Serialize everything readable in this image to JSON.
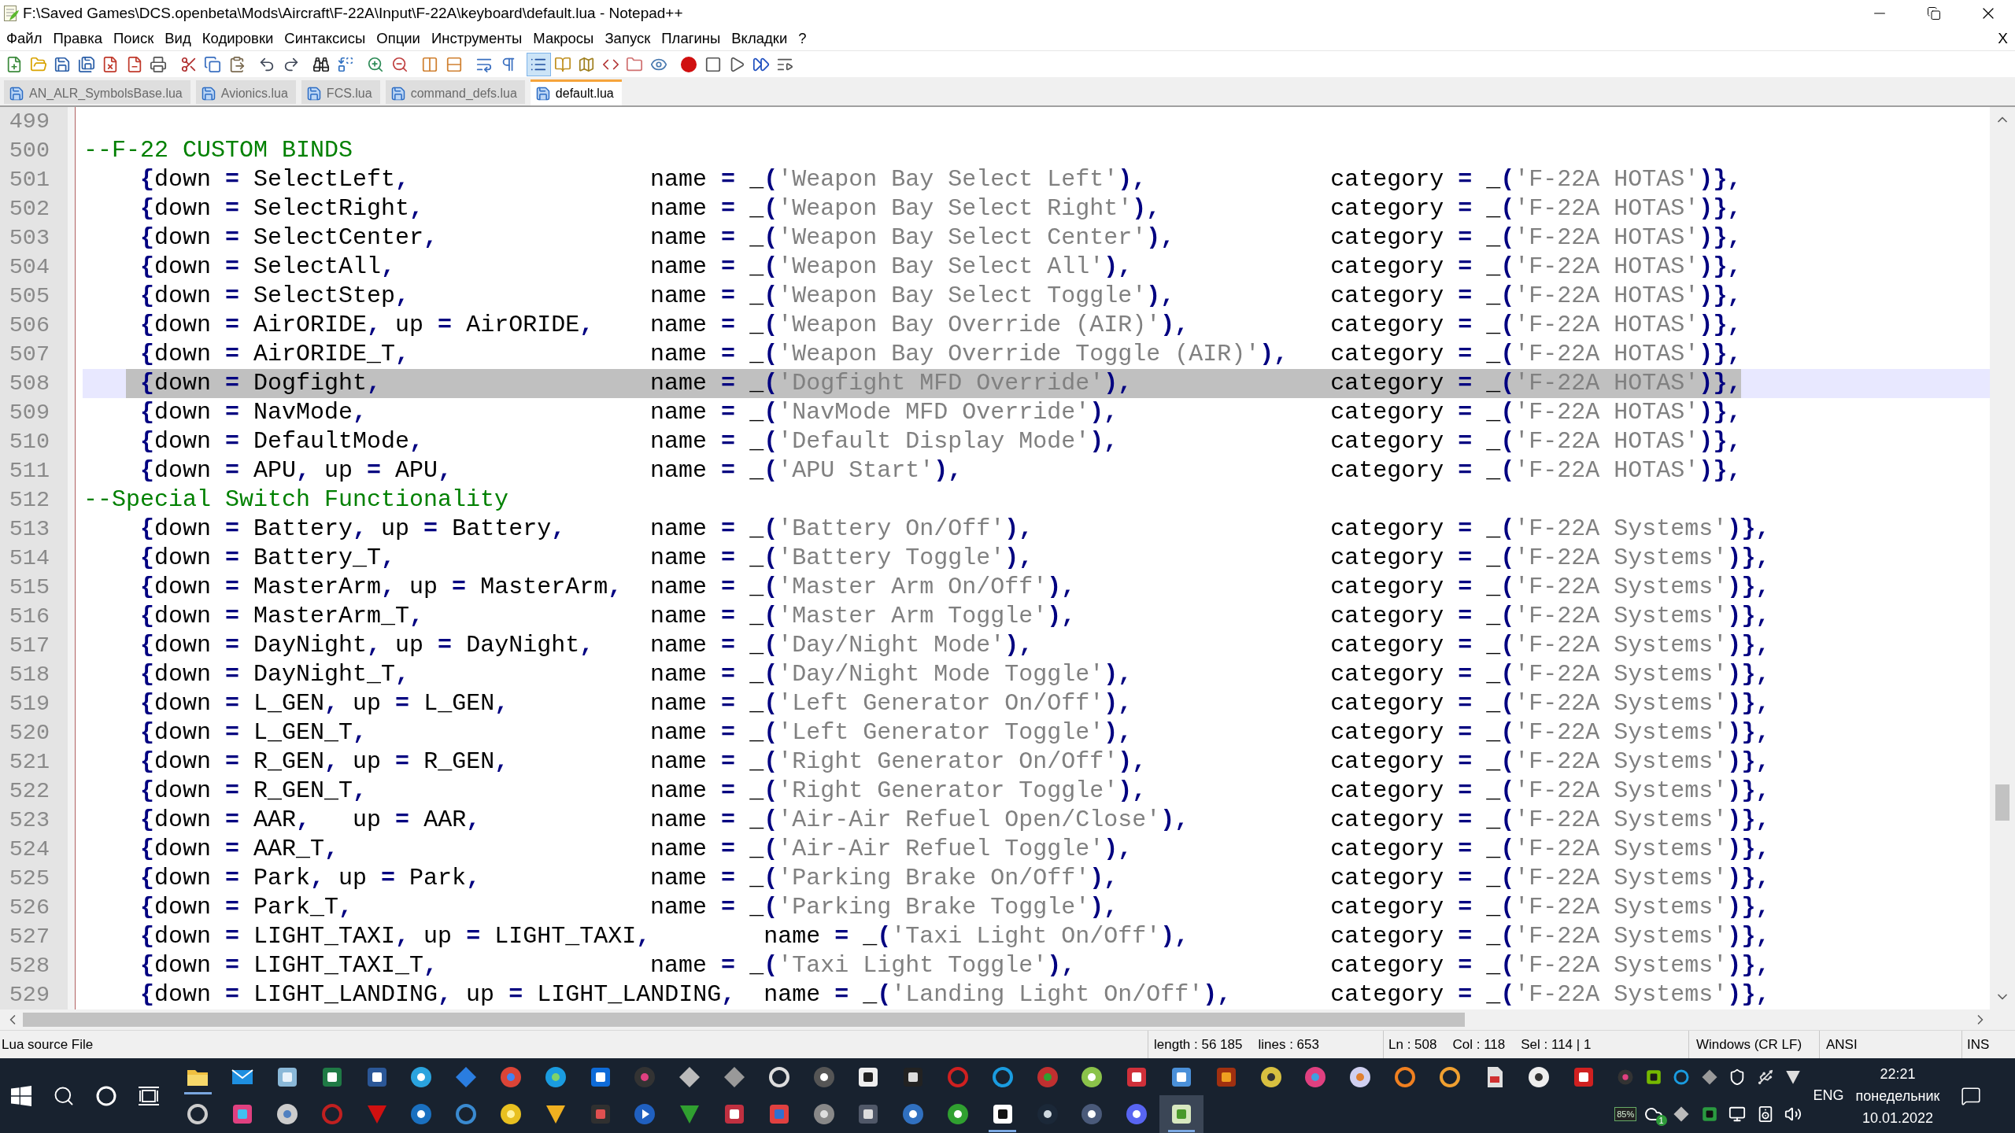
{
  "window": {
    "title": "F:\\Saved Games\\DCS.openbeta\\Mods\\Aircraft\\F-22A\\Input\\F-22A\\keyboard\\default.lua - Notepad++"
  },
  "menu": {
    "items": [
      "Файл",
      "Правка",
      "Поиск",
      "Вид",
      "Кодировки",
      "Синтаксисы",
      "Опции",
      "Инструменты",
      "Макросы",
      "Запуск",
      "Плагины",
      "Вкладки",
      "?"
    ],
    "close": "X"
  },
  "toolbar": {
    "buttons": [
      {
        "pressed": false
      },
      {
        "pressed": false
      },
      {
        "pressed": false
      },
      {
        "pressed": false
      },
      {
        "pressed": false
      },
      {
        "pressed": false
      },
      {
        "pressed": false
      },
      {
        "pressed": false
      },
      {
        "pressed": false
      },
      {
        "pressed": false
      },
      {
        "pressed": false
      },
      {
        "pressed": false
      },
      {
        "pressed": false
      },
      {
        "pressed": false
      },
      {
        "pressed": false
      },
      {
        "pressed": false
      },
      {
        "pressed": false
      },
      {
        "pressed": false
      },
      {
        "pressed": false
      },
      {
        "pressed": false
      },
      {
        "pressed": true
      },
      {
        "pressed": false
      },
      {
        "pressed": false
      },
      {
        "pressed": false
      },
      {
        "pressed": false
      },
      {
        "pressed": false
      },
      {
        "pressed": false
      },
      {
        "pressed": false
      },
      {
        "pressed": false
      },
      {
        "pressed": false
      },
      {
        "pressed": false
      }
    ]
  },
  "tabs": [
    {
      "label": "AN_ALR_SymbolsBase.lua",
      "selected": false
    },
    {
      "label": "Avionics.lua",
      "selected": false
    },
    {
      "label": "FCS.lua",
      "selected": false
    },
    {
      "label": "command_defs.lua",
      "selected": false
    },
    {
      "label": "default.lua",
      "selected": true
    }
  ],
  "editor": {
    "lines": [
      {
        "number": "499",
        "kind": "blank",
        "selected": false
      },
      {
        "number": "500",
        "kind": "comment",
        "text": "--F-22 CUSTOM BINDS",
        "selected": false
      },
      {
        "number": "501",
        "kind": "bind",
        "binding": "{down = SelectLeft,",
        "name": "name = _('Weapon Bay Select Left'),",
        "category": "category = _('F-22A HOTAS')},",
        "selected": false
      },
      {
        "number": "502",
        "kind": "bind",
        "binding": "{down = SelectRight,",
        "name": "name = _('Weapon Bay Select Right'),",
        "category": "category = _('F-22A HOTAS')},",
        "selected": false
      },
      {
        "number": "503",
        "kind": "bind",
        "binding": "{down = SelectCenter,",
        "name": "name = _('Weapon Bay Select Center'),",
        "category": "category = _('F-22A HOTAS')},",
        "selected": false
      },
      {
        "number": "504",
        "kind": "bind",
        "binding": "{down = SelectAll,",
        "name": "name = _('Weapon Bay Select All'),",
        "category": "category = _('F-22A HOTAS')},",
        "selected": false
      },
      {
        "number": "505",
        "kind": "bind",
        "binding": "{down = SelectStep,",
        "name": "name = _('Weapon Bay Select Toggle'),",
        "category": "category = _('F-22A HOTAS')},",
        "selected": false
      },
      {
        "number": "506",
        "kind": "bind",
        "binding": "{down = AirORIDE, up = AirORIDE,",
        "name": "name = _('Weapon Bay Override (AIR)'),",
        "category": "category = _('F-22A HOTAS')},",
        "selected": false
      },
      {
        "number": "507",
        "kind": "bind",
        "binding": "{down = AirORIDE_T,",
        "name": "name = _('Weapon Bay Override Toggle (AIR)'),",
        "category": "category = _('F-22A HOTAS')},",
        "selected": false
      },
      {
        "number": "508",
        "kind": "bind",
        "binding": "{down = Dogfight,",
        "name": "name = _('Dogfight MFD Override'),",
        "category": "category = _('F-22A HOTAS')},",
        "selected": true
      },
      {
        "number": "509",
        "kind": "bind",
        "binding": "{down = NavMode,",
        "name": "name = _('NavMode MFD Override'),",
        "category": "category = _('F-22A HOTAS')},",
        "selected": false
      },
      {
        "number": "510",
        "kind": "bind",
        "binding": "{down = DefaultMode,",
        "name": "name = _('Default Display Mode'),",
        "category": "category = _('F-22A HOTAS')},",
        "selected": false
      },
      {
        "number": "511",
        "kind": "bind",
        "binding": "{down = APU, up = APU,",
        "name": "name = _('APU Start'),",
        "category": "category = _('F-22A HOTAS')},",
        "selected": false
      },
      {
        "number": "512",
        "kind": "comment",
        "text": "--Special Switch Functionality",
        "selected": false
      },
      {
        "number": "513",
        "kind": "bind",
        "binding": "{down = Battery, up = Battery,",
        "name": "name = _('Battery On/Off'),",
        "category": "category = _('F-22A Systems')},",
        "selected": false
      },
      {
        "number": "514",
        "kind": "bind",
        "binding": "{down = Battery_T,",
        "name": "name = _('Battery Toggle'),",
        "category": "category = _('F-22A Systems')},",
        "selected": false
      },
      {
        "number": "515",
        "kind": "bind",
        "binding": "{down = MasterArm, up = MasterArm,",
        "name": "name = _('Master Arm On/Off'),",
        "category": "category = _('F-22A Systems')},",
        "selected": false
      },
      {
        "number": "516",
        "kind": "bind",
        "binding": "{down = MasterArm_T,",
        "name": "name = _('Master Arm Toggle'),",
        "category": "category = _('F-22A Systems')},",
        "selected": false
      },
      {
        "number": "517",
        "kind": "bind",
        "binding": "{down = DayNight, up = DayNight,",
        "name": "name = _('Day/Night Mode'),",
        "category": "category = _('F-22A Systems')},",
        "selected": false
      },
      {
        "number": "518",
        "kind": "bind",
        "binding": "{down = DayNight_T,",
        "name": "name = _('Day/Night Mode Toggle'),",
        "category": "category = _('F-22A Systems')},",
        "selected": false
      },
      {
        "number": "519",
        "kind": "bind",
        "binding": "{down = L_GEN, up = L_GEN,",
        "name": "name = _('Left Generator On/Off'),",
        "category": "category = _('F-22A Systems')},",
        "selected": false
      },
      {
        "number": "520",
        "kind": "bind",
        "binding": "{down = L_GEN_T,",
        "name": "name = _('Left Generator Toggle'),",
        "category": "category = _('F-22A Systems')},",
        "selected": false
      },
      {
        "number": "521",
        "kind": "bind",
        "binding": "{down = R_GEN, up = R_GEN,",
        "name": "name = _('Right Generator On/Off'),",
        "category": "category = _('F-22A Systems')},",
        "selected": false
      },
      {
        "number": "522",
        "kind": "bind",
        "binding": "{down = R_GEN_T,",
        "name": "name = _('Right Generator Toggle'),",
        "category": "category = _('F-22A Systems')},",
        "selected": false
      },
      {
        "number": "523",
        "kind": "bind",
        "binding": "{down = AAR,   up = AAR,",
        "name": "name = _('Air-Air Refuel Open/Close'),",
        "category": "category = _('F-22A Systems')},",
        "selected": false
      },
      {
        "number": "524",
        "kind": "bind",
        "binding": "{down = AAR_T,",
        "name": "name = _('Air-Air Refuel Toggle'),",
        "category": "category = _('F-22A Systems')},",
        "selected": false
      },
      {
        "number": "525",
        "kind": "bind",
        "binding": "{down = Park, up = Park,",
        "name": "name = _('Parking Brake On/Off'),",
        "category": "category = _('F-22A Systems')},",
        "selected": false
      },
      {
        "number": "526",
        "kind": "bind",
        "binding": "{down = Park_T,",
        "name": "name = _('Parking Brake Toggle'),",
        "category": "category = _('F-22A Systems')},",
        "selected": false
      },
      {
        "number": "527",
        "kind": "bind",
        "binding": "{down = LIGHT_TAXI, up = LIGHT_TAXI,",
        "name": "name = _('Taxi Light On/Off'),",
        "category": "category = _('F-22A Systems')},",
        "selected": false
      },
      {
        "number": "528",
        "kind": "bind",
        "binding": "{down = LIGHT_TAXI_T,",
        "name": "name = _('Taxi Light Toggle'),",
        "category": "category = _('F-22A Systems')},",
        "selected": false
      },
      {
        "number": "529",
        "kind": "bind",
        "binding": "{down = LIGHT_LANDING, up = LIGHT_LANDING,",
        "name": "name = _('Landing Light On/Off'),",
        "category": "category = _('F-22A Systems')},",
        "selected": false
      }
    ]
  },
  "status_bar": {
    "file_type": "Lua source File",
    "length": "length : 56 185",
    "lines": "lines : 653",
    "line": "Ln : 508",
    "column": "Col : 118",
    "selection": "Sel : 114 | 1",
    "line_endings": "Windows (CR LF)",
    "encoding": "ANSI",
    "insert_mode": "INS"
  },
  "taskbar": {
    "top_row": [
      {
        "running": true,
        "selected": false
      },
      {
        "running": false,
        "selected": false
      },
      {
        "running": false,
        "selected": false
      },
      {
        "running": false,
        "selected": false
      },
      {
        "running": false,
        "selected": false
      },
      {
        "running": false,
        "selected": false
      },
      {
        "running": false,
        "selected": false
      },
      {
        "running": false,
        "selected": false
      },
      {
        "running": false,
        "selected": false
      },
      {
        "running": false,
        "selected": false
      },
      {
        "running": false,
        "selected": false
      },
      {
        "running": false,
        "selected": false
      },
      {
        "running": false,
        "selected": false
      },
      {
        "running": false,
        "selected": false
      },
      {
        "running": false,
        "selected": false
      },
      {
        "running": false,
        "selected": false
      },
      {
        "running": false,
        "selected": false
      },
      {
        "running": false,
        "selected": false
      },
      {
        "running": false,
        "selected": false
      },
      {
        "running": false,
        "selected": false
      },
      {
        "running": false,
        "selected": false
      },
      {
        "running": false,
        "selected": false
      },
      {
        "running": false,
        "selected": false
      },
      {
        "running": false,
        "selected": false
      },
      {
        "running": false,
        "selected": false
      },
      {
        "running": false,
        "selected": false
      },
      {
        "running": false,
        "selected": false
      },
      {
        "running": false,
        "selected": false
      },
      {
        "running": false,
        "selected": false
      },
      {
        "running": false,
        "selected": false
      },
      {
        "running": false,
        "selected": false
      },
      {
        "running": false,
        "selected": false
      }
    ],
    "bottom_row": [
      {
        "running": false,
        "selected": false
      },
      {
        "running": false,
        "selected": false
      },
      {
        "running": false,
        "selected": false
      },
      {
        "running": false,
        "selected": false
      },
      {
        "running": false,
        "selected": false
      },
      {
        "running": false,
        "selected": false
      },
      {
        "running": false,
        "selected": false
      },
      {
        "running": false,
        "selected": false
      },
      {
        "running": false,
        "selected": false
      },
      {
        "running": false,
        "selected": false
      },
      {
        "running": false,
        "selected": false
      },
      {
        "running": false,
        "selected": false
      },
      {
        "running": false,
        "selected": false
      },
      {
        "running": false,
        "selected": false
      },
      {
        "running": false,
        "selected": false
      },
      {
        "running": false,
        "selected": false
      },
      {
        "running": false,
        "selected": false
      },
      {
        "running": false,
        "selected": false
      },
      {
        "running": true,
        "selected": false
      },
      {
        "running": false,
        "selected": false
      },
      {
        "running": false,
        "selected": false
      },
      {
        "running": false,
        "selected": false
      },
      {
        "running": true,
        "selected": true
      }
    ],
    "tray": {
      "gauge": "85%",
      "badge": "1"
    },
    "language": "ENG",
    "time": "22:21",
    "weekday": "понедельник",
    "date": "10.01.2022"
  }
}
